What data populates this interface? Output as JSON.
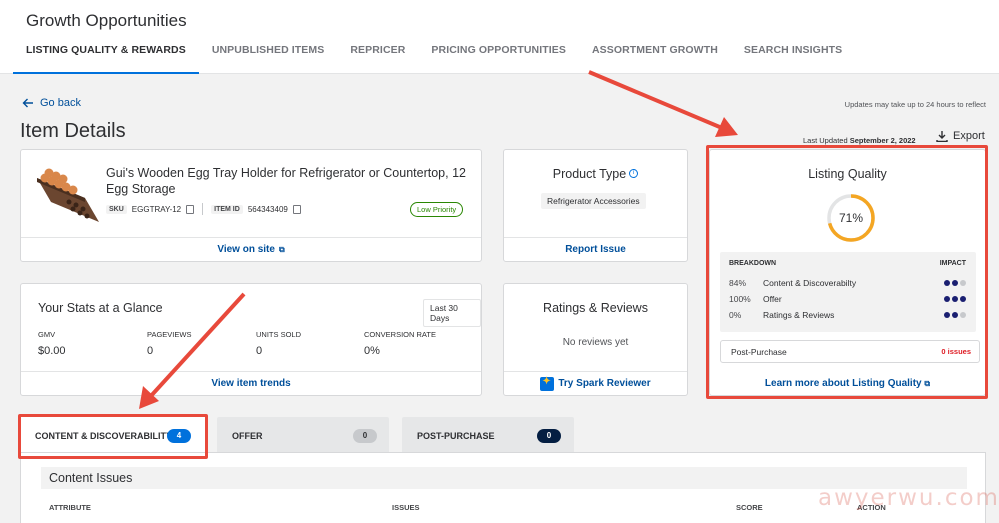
{
  "header": {
    "title": "Growth Opportunities",
    "tabs": [
      {
        "label": "LISTING QUALITY & REWARDS",
        "active": true
      },
      {
        "label": "UNPUBLISHED ITEMS",
        "active": false
      },
      {
        "label": "REPRICER",
        "active": false
      },
      {
        "label": "PRICING OPPORTUNITIES",
        "active": false
      },
      {
        "label": "ASSORTMENT GROWTH",
        "active": false
      },
      {
        "label": "SEARCH INSIGHTS",
        "active": false
      }
    ]
  },
  "page": {
    "go_back": "Go back",
    "updates_note": "Updates may take up to 24 hours to reflect",
    "title": "Item Details",
    "last_updated_label": "Last Updated",
    "last_updated_date": "September 2, 2022",
    "export_label": "Export"
  },
  "product": {
    "name": "Gui's Wooden Egg Tray Holder for Refrigerator or Countertop, 12 Egg Storage",
    "sku_label": "SKU",
    "sku": "EGGTRAY-12",
    "item_id_label": "ITEM ID",
    "item_id": "564343409",
    "priority": "Low Priority",
    "view_link": "View on site"
  },
  "product_type": {
    "title": "Product Type",
    "value": "Refrigerator Accessories",
    "link": "Report Issue"
  },
  "stats": {
    "title": "Your Stats at a Glance",
    "period": "Last 30 Days",
    "items": [
      {
        "label": "GMV",
        "value": "$0.00"
      },
      {
        "label": "PAGEVIEWS",
        "value": "0"
      },
      {
        "label": "UNITS SOLD",
        "value": "0"
      },
      {
        "label": "CONVERSION RATE",
        "value": "0%"
      }
    ],
    "link": "View item trends"
  },
  "ratings": {
    "title": "Ratings & Reviews",
    "empty": "No reviews yet",
    "link": "Try Spark Reviewer"
  },
  "listing_quality": {
    "title": "Listing Quality",
    "score": "71%",
    "score_value": 71,
    "breakdown_label": "BREAKDOWN",
    "impact_label": "IMPACT",
    "rows": [
      {
        "pct": "84%",
        "name": "Content & Discoverabilty",
        "impact": 2
      },
      {
        "pct": "100%",
        "name": "Offer",
        "impact": 3
      },
      {
        "pct": "0%",
        "name": "Ratings & Reviews",
        "impact": 2
      }
    ],
    "post_purchase": {
      "name": "Post-Purchase",
      "issues": "0 issues"
    },
    "link": "Learn more about Listing Quality"
  },
  "section_tabs": [
    {
      "label": "CONTENT & DISCOVERABILITY",
      "count": "4",
      "active": true
    },
    {
      "label": "OFFER",
      "count": "0",
      "active": false
    },
    {
      "label": "POST-PURCHASE",
      "count": "0",
      "active": false
    }
  ],
  "issues": {
    "title": "Content Issues",
    "columns": [
      "ATTRIBUTE",
      "ISSUES",
      "SCORE",
      "ACTION"
    ]
  },
  "watermark": "awyerwu.com",
  "colors": {
    "accent": "#0071dc",
    "link": "#004f9a",
    "ring": "#f4a623",
    "highlight": "#e8493b"
  }
}
